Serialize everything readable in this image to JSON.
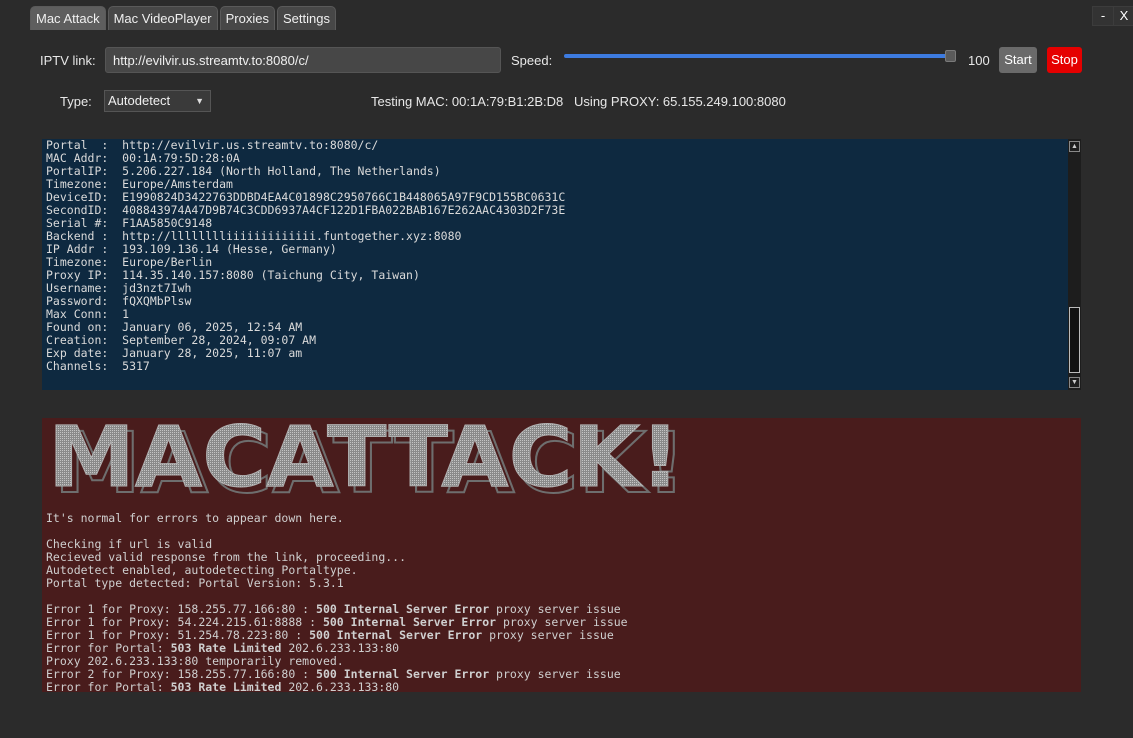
{
  "tabs": [
    "Mac Attack",
    "Mac VideoPlayer",
    "Proxies",
    "Settings"
  ],
  "window_controls": {
    "minimize": "-",
    "close": "X"
  },
  "form": {
    "iptv_label": "IPTV link:",
    "iptv_value": "http://evilvir.us.streamtv.to:8080/c/",
    "speed_label": "Speed:",
    "speed_value": "100",
    "speed_fraction": 1.0,
    "start_label": "Start",
    "stop_label": "Stop",
    "type_label": "Type:",
    "type_value": "Autodetect",
    "status": "Testing MAC: 00:1A:79:B1:2B:D8   Using PROXY: 65.155.249.100:8080"
  },
  "colors": {
    "accent": "#3d7be0",
    "stop": "#e50000",
    "output_bg": "#0e2940",
    "error_bg": "#491c1c"
  },
  "result_lines": [
    "Portal  :  http://evilvir.us.streamtv.to:8080/c/",
    "MAC Addr:  00:1A:79:5D:28:0A",
    "PortalIP:  5.206.227.184 (North Holland, The Netherlands)",
    "Timezone:  Europe/Amsterdam",
    "DeviceID:  E1990824D3422763DDBD4EA4C01898C2950766C1B448065A97F9CD155BC0631C",
    "SecondID:  408843974A47D9B74C3CDD6937A4CF122D1FBA022BAB167E262AAC4303D2F73E",
    "Serial #:  F1AA5850C9148",
    "Backend :  http://lllllllliiiiiiiiiiiii.funtogether.xyz:8080",
    "IP Addr :  193.109.136.14 (Hesse, Germany)",
    "Timezone:  Europe/Berlin",
    "Proxy IP:  114.35.140.157:8080 (Taichung City, Taiwan)",
    "Username:  jd3nzt7Iwh",
    "Password:  fQXQMbPlsw",
    "Max Conn:  1",
    "Found on:  January 06, 2025, 12:54 AM",
    "Creation:  September 28, 2024, 09:07 AM",
    "Exp date:  January 28, 2025, 11:07 am",
    "Channels:  5317"
  ],
  "banner_text": "MACATTACK!",
  "log": {
    "intro": "It's normal for errors to appear down here.",
    "checking": [
      "Checking if url is valid",
      "Recieved valid response from the link, proceeding...",
      "Autodetect enabled, autodetecting Portaltype.",
      "Portal type detected: Portal Version: 5.3.1"
    ],
    "errors": [
      {
        "pre": "Error 1 for Proxy: 158.255.77.166:80 : ",
        "bold": "500 Internal Server Error",
        "post": " proxy server issue"
      },
      {
        "pre": "Error 1 for Proxy: 54.224.215.61:8888 : ",
        "bold": "500 Internal Server Error",
        "post": " proxy server issue"
      },
      {
        "pre": "Error 1 for Proxy: 51.254.78.223:80 : ",
        "bold": "500 Internal Server Error",
        "post": " proxy server issue"
      },
      {
        "pre": "Error for Portal: ",
        "bold": "503 Rate Limited",
        "post": " 202.6.233.133:80"
      },
      {
        "pre": "Proxy 202.6.233.133:80 temporarily removed.",
        "bold": "",
        "post": ""
      },
      {
        "pre": "Error 2 for Proxy: 158.255.77.166:80 : ",
        "bold": "500 Internal Server Error",
        "post": " proxy server issue"
      },
      {
        "pre": "Error for Portal: ",
        "bold": "503 Rate Limited",
        "post": " 202.6.233.133:80"
      }
    ]
  }
}
